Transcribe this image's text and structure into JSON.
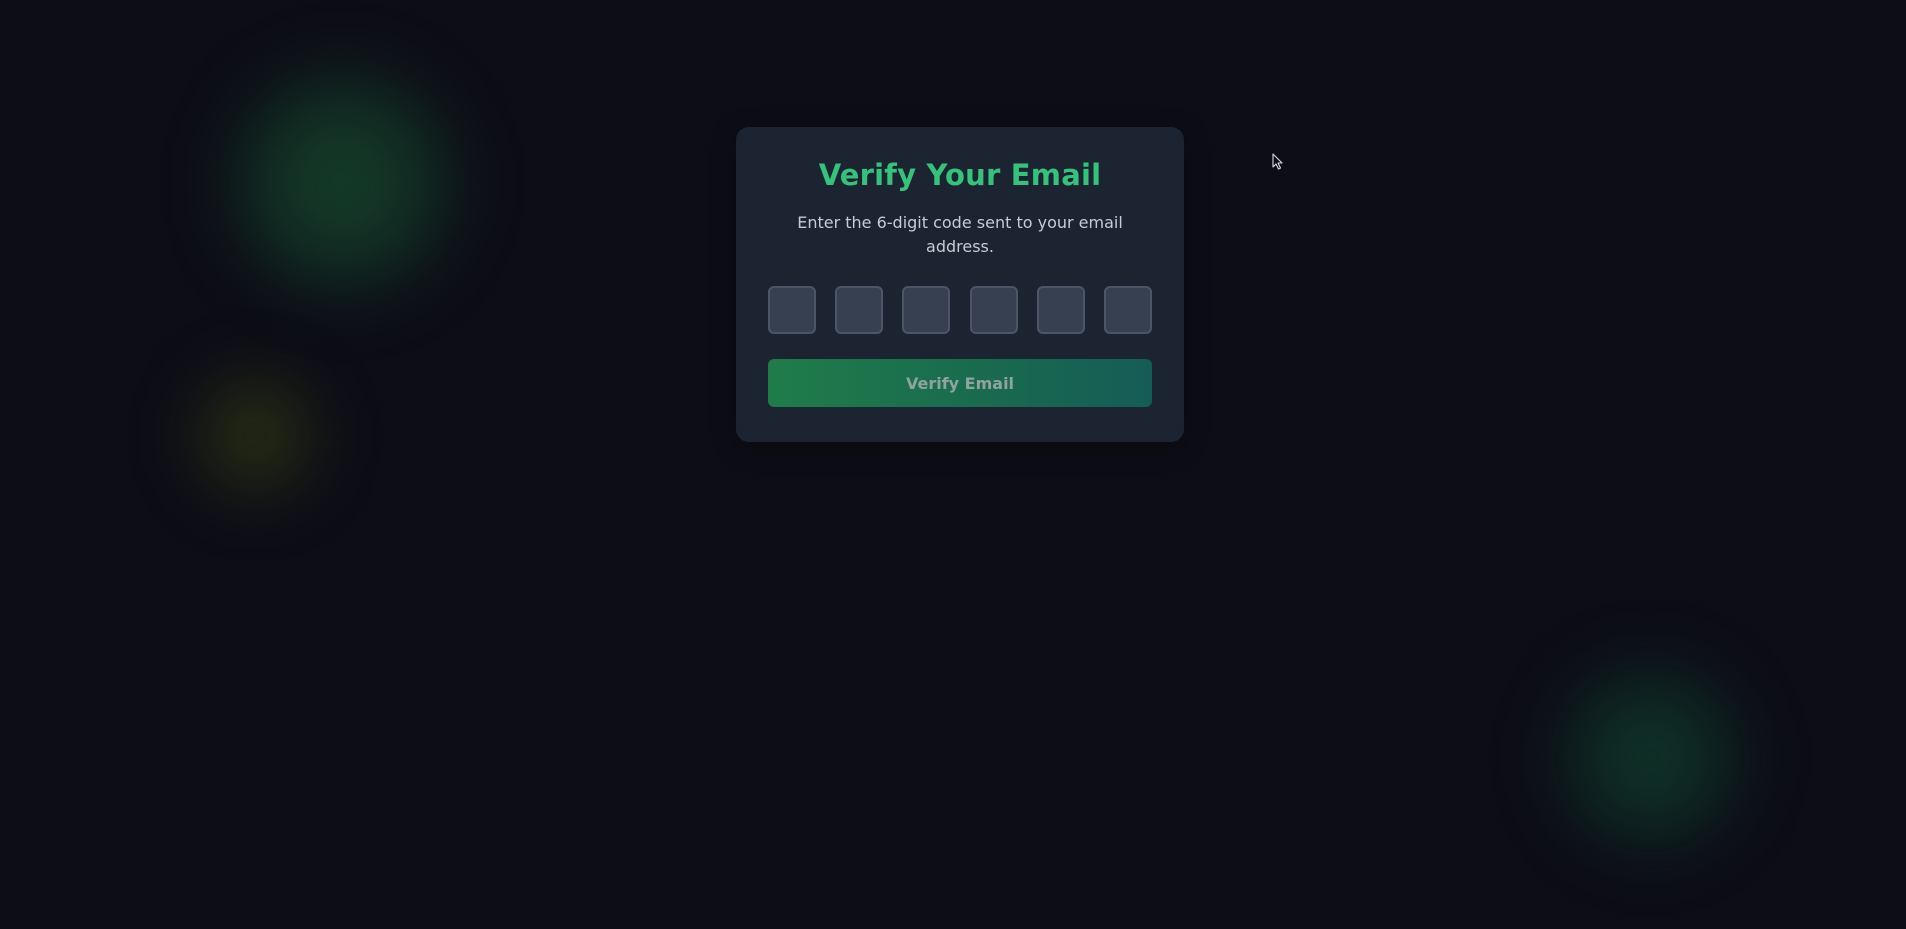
{
  "colors": {
    "background": "#0d0d16",
    "card": "#1c2431",
    "accent": "#34c27c",
    "button_gradient_start": "#1f7c4a",
    "button_gradient_end": "#155c57",
    "input_fill": "#364050",
    "input_border": "#4b5567"
  },
  "verify_card": {
    "title": "Verify Your Email",
    "subtitle": "Enter the 6-digit code sent to your email address.",
    "code_inputs": [
      "",
      "",
      "",
      "",
      "",
      ""
    ],
    "verify_button_label": "Verify Email",
    "verify_button_disabled": true
  },
  "pointer": {
    "icon": "cursor-arrow-icon"
  }
}
